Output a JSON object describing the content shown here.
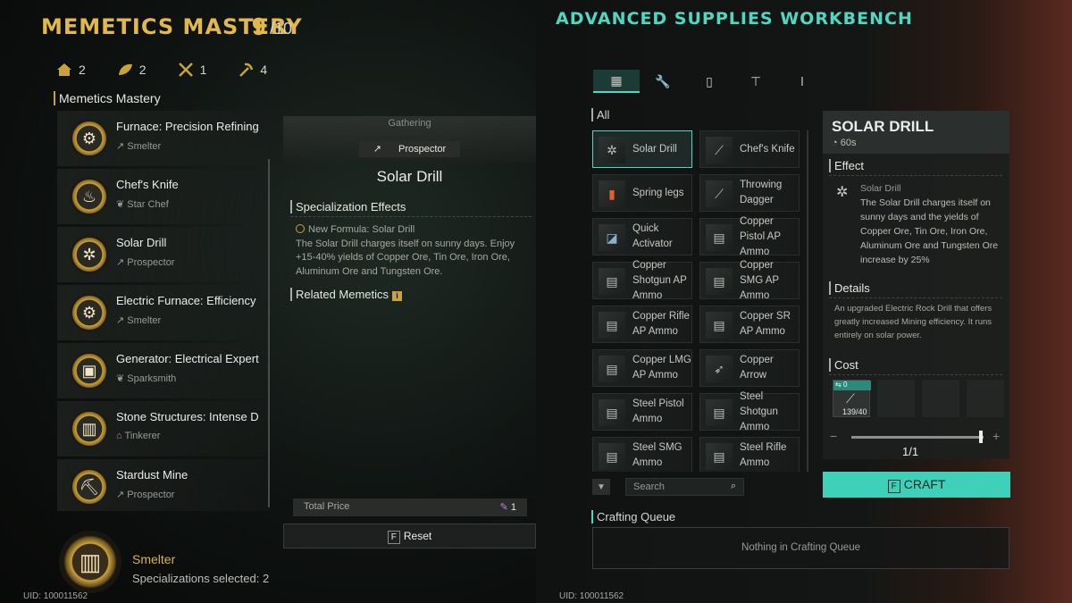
{
  "left": {
    "title": "MEMETICS MASTERY",
    "level": "9",
    "level_max": "/10",
    "stats": [
      {
        "icon": "home-icon",
        "value": "2"
      },
      {
        "icon": "leaf-icon",
        "value": "2"
      },
      {
        "icon": "crossed-tools-icon",
        "value": "1"
      },
      {
        "icon": "pickaxe-icon",
        "value": "4"
      }
    ],
    "section": "Memetics Mastery",
    "items": [
      {
        "name": "Furnace: Precision Refining",
        "profession": "Smelter",
        "prof_icon": "pick-icon"
      },
      {
        "name": "Chef's Knife",
        "profession": "Star Chef",
        "prof_icon": "leaf-icon"
      },
      {
        "name": "Solar Drill",
        "profession": "Prospector",
        "prof_icon": "pick-icon"
      },
      {
        "name": "Electric Furnace: Efficiency",
        "profession": "Smelter",
        "prof_icon": "pick-icon"
      },
      {
        "name": "Generator: Electrical Expert",
        "profession": "Sparksmith",
        "prof_icon": "leaf-icon"
      },
      {
        "name": "Stone Structures: Intense D",
        "profession": "Tinkerer",
        "prof_icon": "home-icon"
      },
      {
        "name": "Stardust Mine",
        "profession": "Prospector",
        "prof_icon": "pick-icon"
      }
    ],
    "detail": {
      "category": "Gathering",
      "profession": "Prospector",
      "name": "Solar Drill",
      "spec_header": "Specialization Effects",
      "formula_title": "New Formula: Solar Drill",
      "formula_text": "The Solar Drill charges itself on sunny days. Enjoy +15-40% yields of Copper Ore, Tin Ore, Iron Ore, Aluminum Ore and Tungsten Ore.",
      "related_header": "Related Memetics",
      "total_label": "Total Price",
      "total_value": "1",
      "reset_key": "F",
      "reset_label": "Reset"
    },
    "footer": {
      "profession": "Smelter",
      "selected": "Specializations selected: 2",
      "uid": "UID: 100011562"
    }
  },
  "right": {
    "title": "ADVANCED SUPPLIES WORKBENCH",
    "tabs": [
      "grid-icon",
      "wrench-icon",
      "bottle-icon",
      "hammer-icon",
      "tool-icon"
    ],
    "filter_label": "All",
    "items": [
      {
        "label": "Solar Drill",
        "icon": "drill-icon",
        "selected": true
      },
      {
        "label": "Chef's Knife",
        "icon": "knife-icon"
      },
      {
        "label": "Spring legs",
        "icon": "canister-icon"
      },
      {
        "label": "Throwing Dagger",
        "icon": "dagger-icon"
      },
      {
        "label": "Quick Activator",
        "icon": "device-icon"
      },
      {
        "label": "Copper Pistol AP Ammo",
        "icon": "ammo-box-icon"
      },
      {
        "label": "Copper Shotgun AP Ammo",
        "icon": "ammo-box-icon"
      },
      {
        "label": "Copper SMG AP Ammo",
        "icon": "ammo-box-icon"
      },
      {
        "label": "Copper Rifle AP Ammo",
        "icon": "ammo-box-icon"
      },
      {
        "label": "Copper SR AP Ammo",
        "icon": "ammo-box-icon"
      },
      {
        "label": "Copper LMG AP Ammo",
        "icon": "ammo-box-icon"
      },
      {
        "label": "Copper Arrow",
        "icon": "arrow-icon"
      },
      {
        "label": "Steel Pistol Ammo",
        "icon": "ammo-box-icon"
      },
      {
        "label": "Steel Shotgun Ammo",
        "icon": "ammo-box-icon"
      },
      {
        "label": "Steel SMG Ammo",
        "icon": "ammo-box-icon"
      },
      {
        "label": "Steel Rifle Ammo",
        "icon": "ammo-box-icon"
      }
    ],
    "search_placeholder": "Search",
    "queue_header": "Crafting Queue",
    "queue_empty": "Nothing in Crafting Queue",
    "card": {
      "title": "SOLAR DRILL",
      "time": "60s",
      "effect_header": "Effect",
      "effect_name": "Solar Drill",
      "effect_text": "The Solar Drill charges itself on sunny days and the yields of Copper Ore, Tin Ore, Iron Ore, Aluminum Ore and Tungsten Ore increase by 25%",
      "details_header": "Details",
      "details_text": "An upgraded Electric Rock Drill that offers greatly increased Mining efficiency. It runs entirely on solar power.",
      "cost_header": "Cost",
      "cost_tag": "0",
      "cost_amount": "139/40",
      "quantity": "1/1",
      "craft_key": "F",
      "craft_label": "CRAFT"
    },
    "uid": "UID: 100011562",
    "accent": "#4fd8c0"
  }
}
